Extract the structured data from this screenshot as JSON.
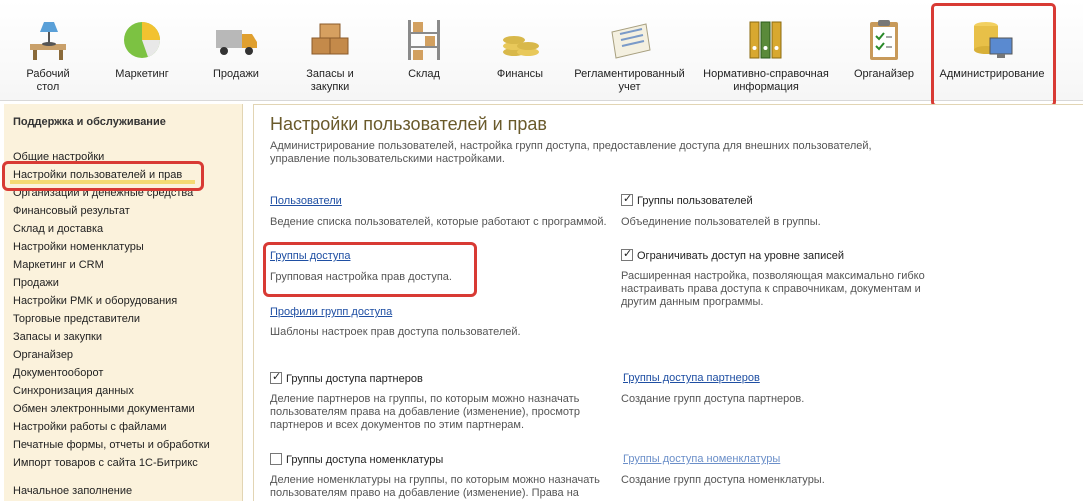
{
  "toolbar": {
    "items": [
      {
        "label": "Рабочий\nстол",
        "icon": "desk-icon"
      },
      {
        "label": "Маркетинг",
        "icon": "pie-chart-icon"
      },
      {
        "label": "Продажи",
        "icon": "truck-icon"
      },
      {
        "label": "Запасы и\nзакупки",
        "icon": "boxes-icon"
      },
      {
        "label": "Склад",
        "icon": "shelf-icon"
      },
      {
        "label": "Финансы",
        "icon": "coins-icon"
      },
      {
        "label": "Регламентированный\nучет",
        "icon": "report-icon"
      },
      {
        "label": "Нормативно-справочная\nинформация",
        "icon": "binders-icon"
      },
      {
        "label": "Органайзер",
        "icon": "clipboard-icon"
      },
      {
        "label": "Администрирование",
        "icon": "database-computer-icon"
      }
    ]
  },
  "sidebar": {
    "title": "Поддержка и обслуживание",
    "items": [
      "Общие настройки",
      "Настройки пользователей и прав",
      "Организации и денежные средства",
      "Финансовый результат",
      "Склад и доставка",
      "Настройки номенклатуры",
      "Маркетинг и CRM",
      "Продажи",
      "Настройки РМК и оборудования",
      "Торговые представители",
      "Запасы и закупки",
      "Органайзер",
      "Документооборот",
      "Синхронизация данных",
      "Обмен электронными документами",
      "Настройки работы с файлами",
      "Печатные формы, отчеты и обработки",
      "Импорт товаров с сайта 1С-Битрикс"
    ],
    "extra": "Начальное заполнение"
  },
  "main": {
    "title": "Настройки пользователей и прав",
    "description": "Администрирование пользователей, настройка групп доступа, предоставление доступа для внешних пользователей, управление пользовательскими настройками.",
    "users_link": "Пользователи",
    "users_desc": "Ведение списка пользователей, которые работают с программой.",
    "access_groups_link": "Группы доступа",
    "access_groups_desc": "Групповая настройка прав доступа.",
    "profiles_link": "Профили групп доступа",
    "profiles_desc": "Шаблоны настроек прав доступа пользователей.",
    "user_groups_check": "Группы пользователей",
    "user_groups_desc": "Объединение пользователей в группы.",
    "record_level_check": "Ограничивать доступ на уровне записей",
    "record_level_desc": "Расширенная настройка, позволяющая максимально гибко настраивать права доступа к справочникам, документам и другим данным программы.",
    "partner_groups_check": "Группы доступа партнеров",
    "partner_groups_desc": "Деление партнеров на группы, по которым можно назначать пользователям права на добавление (изменение), просмотр партнеров и всех документов по этим партнерам.",
    "partner_groups_link": "Группы доступа партнеров",
    "partner_groups_link_desc": "Создание групп доступа партнеров.",
    "nomenclature_groups_check": "Группы доступа номенклатуры",
    "nomenclature_groups_desc": "Деление номенклатуры на группы, по которым можно назначать пользователям право на добавление (изменение). Права на",
    "nomenclature_groups_link": "Группы доступа номенклатуры",
    "nomenclature_groups_link_desc": "Создание групп доступа номенклатуры."
  },
  "checks": {
    "user_groups": true,
    "record_level": true,
    "partner_groups": true,
    "nomenclature_groups": false
  },
  "colors": {
    "highlight": "#d83a34",
    "sidebar_bg": "#fbf2dc",
    "title": "#6a5a2b",
    "link": "#1f4fa3"
  }
}
